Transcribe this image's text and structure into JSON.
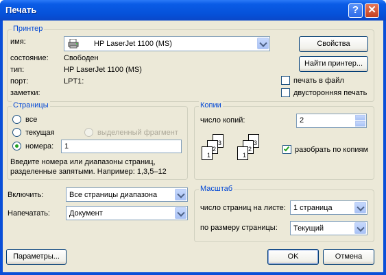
{
  "window": {
    "title": "Печать",
    "help": "?",
    "close": "✕"
  },
  "printer": {
    "legend": "Принтер",
    "name_label": "имя:",
    "name_value": "HP LaserJet 1100 (MS)",
    "state_label": "состояние:",
    "state_value": "Свободен",
    "type_label": "тип:",
    "type_value": "HP LaserJet 1100 (MS)",
    "port_label": "порт:",
    "port_value": "LPT1:",
    "notes_label": "заметки:",
    "properties_button": "Свойства",
    "find_button": "Найти принтер...",
    "print_to_file": "печать в файл",
    "duplex": "двусторонняя печать"
  },
  "pages": {
    "legend": "Страницы",
    "all": "все",
    "current": "текущая",
    "selection": "выделенный фрагмент",
    "numbers": "номера:",
    "numbers_value": "1",
    "hint": "Введите номера или диапазоны страниц, разделенные запятыми. Например: 1,3,5–12"
  },
  "copies": {
    "legend": "Копии",
    "count_label": "число копий:",
    "count_value": "2",
    "collate": "разобрать по копиям",
    "collate_checked": true,
    "stack_labels": [
      "3",
      "2",
      "1"
    ]
  },
  "include": {
    "label": "Включить:",
    "value": "Все страницы диапазона"
  },
  "print_what": {
    "label": "Напечатать:",
    "value": "Документ"
  },
  "zoom": {
    "legend": "Масштаб",
    "per_sheet_label": "число страниц на листе:",
    "per_sheet_value": "1 страница",
    "scale_label": "по размеру страницы:",
    "scale_value": "Текущий"
  },
  "footer": {
    "options": "Параметры...",
    "ok": "OK",
    "cancel": "Отмена"
  },
  "colors": {
    "title_blue": "#0551d9",
    "face": "#ece9d8",
    "legend": "#0046d5",
    "check_green": "#21a121"
  }
}
